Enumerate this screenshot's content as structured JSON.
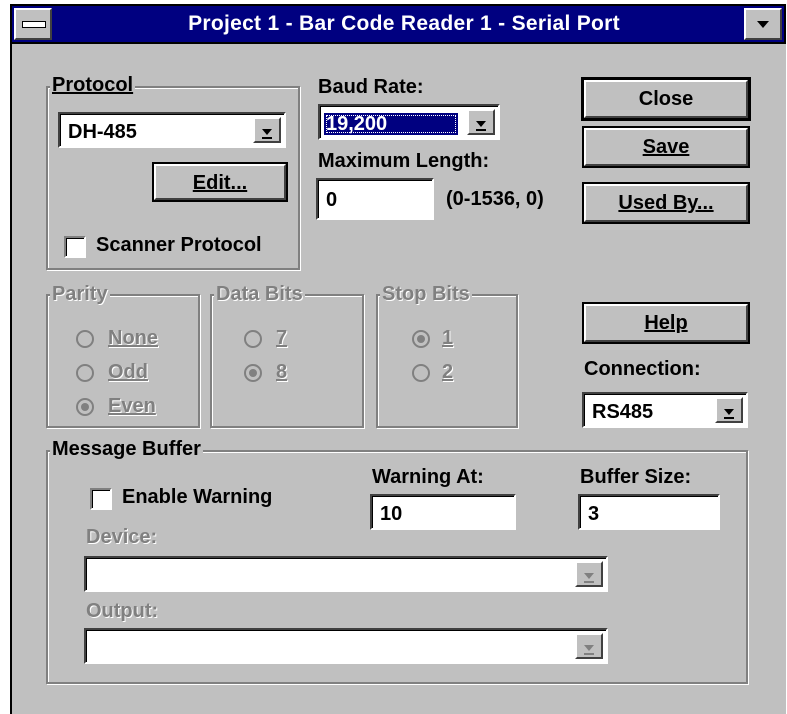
{
  "window": {
    "title": "Project 1 - Bar Code Reader 1 - Serial Port"
  },
  "protocol": {
    "group_label": "Protocol",
    "value": "DH-485",
    "edit_label": "Edit...",
    "scanner_label": "Scanner Protocol",
    "scanner_checked": false
  },
  "baud": {
    "label": "Baud Rate:",
    "value": "19,200"
  },
  "maxlen": {
    "label": "Maximum Length:",
    "value": "0",
    "range": "(0-1536, 0)"
  },
  "buttons": {
    "close": "Close",
    "save": "Save",
    "used_by": "Used By...",
    "help": "Help"
  },
  "parity": {
    "label": "Parity",
    "options": [
      {
        "label": "None",
        "selected": false
      },
      {
        "label": "Odd",
        "selected": false
      },
      {
        "label": "Even",
        "selected": true
      }
    ]
  },
  "data_bits": {
    "label": "Data Bits",
    "options": [
      {
        "label": "7",
        "selected": false
      },
      {
        "label": "8",
        "selected": true
      }
    ]
  },
  "stop_bits": {
    "label": "Stop Bits",
    "options": [
      {
        "label": "1",
        "selected": true
      },
      {
        "label": "2",
        "selected": false
      }
    ]
  },
  "connection": {
    "label": "Connection:",
    "value": "RS485"
  },
  "message_buffer": {
    "label": "Message Buffer",
    "enable_warning_label": "Enable Warning",
    "enable_warning_checked": false,
    "warning_at_label": "Warning At:",
    "warning_at_value": "10",
    "buffer_size_label": "Buffer Size:",
    "buffer_size_value": "3",
    "device_label": "Device:",
    "device_value": "",
    "output_label": "Output:",
    "output_value": ""
  },
  "icons": {
    "dropdown": "down-arrow-icon",
    "system_menu": "system-menu-icon",
    "minimize": "minimize-icon"
  },
  "colors": {
    "titlebar": "#000080",
    "face": "#c0c0c0",
    "disabled_text": "#808080"
  }
}
